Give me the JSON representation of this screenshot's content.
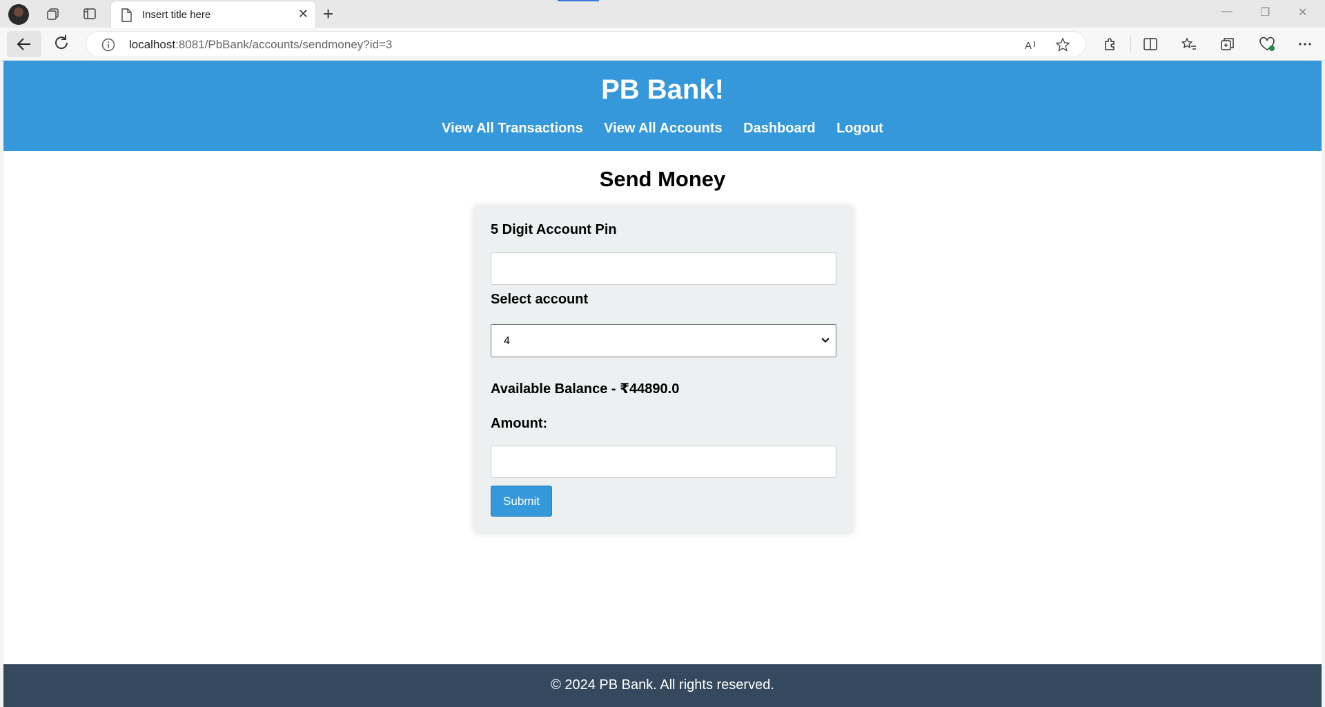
{
  "browser": {
    "tab_title": "Insert title here",
    "url_host": "localhost",
    "url_rest": ":8081/PbBank/accounts/sendmoney?id=3",
    "icons": [
      "avatar",
      "workspaces-icon",
      "tab-actions-icon",
      "page-icon",
      "close-icon",
      "new-tab-icon",
      "minimize-icon",
      "restore-icon",
      "window-close-icon",
      "back-icon",
      "reload-icon",
      "info-icon",
      "read-aloud-icon",
      "favorite-star-icon",
      "extensions-icon",
      "split-screen-icon",
      "favorites-icon",
      "collections-icon",
      "browser-essentials-icon",
      "more-icon"
    ]
  },
  "site": {
    "brand": "PB Bank!",
    "nav": [
      "View All Transactions",
      "View All Accounts",
      "Dashboard",
      "Logout"
    ],
    "header_color": "#3498db",
    "footer_color": "#34495e",
    "footer_text": "© 2024 PB Bank. All rights reserved."
  },
  "form": {
    "page_title": "Send Money",
    "pin_label": "5 Digit Account Pin",
    "pin_value": "",
    "account_label": "Select account",
    "account_selected": "4",
    "balance_text": "Available Balance - ₹44890.0",
    "amount_label": "Amount:",
    "amount_value": "",
    "submit_label": "Submit"
  }
}
